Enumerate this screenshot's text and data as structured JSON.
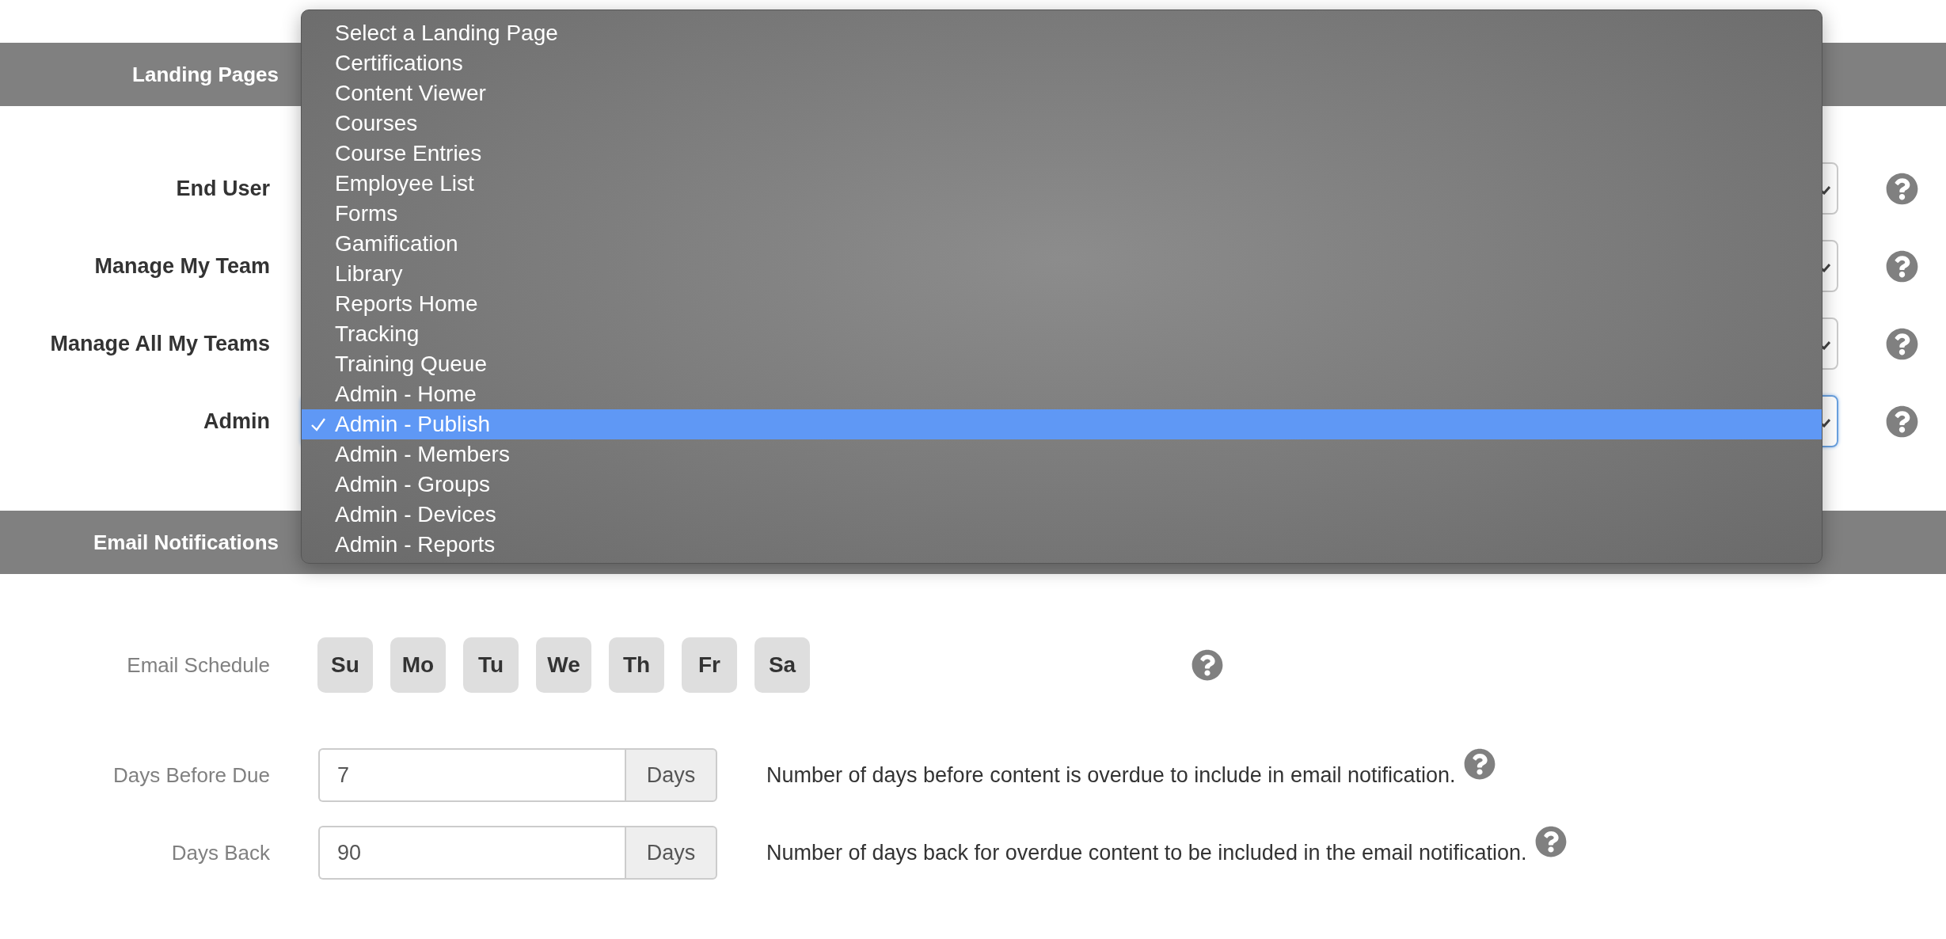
{
  "landing_pages": {
    "title": "Landing Pages",
    "rows": [
      {
        "label": "End User",
        "focused": false
      },
      {
        "label": "Manage My Team",
        "focused": false
      },
      {
        "label": "Manage All My Teams",
        "focused": false
      },
      {
        "label": "Admin",
        "focused": true
      }
    ]
  },
  "dropdown": {
    "options": [
      {
        "label": "Select a Landing Page",
        "selected": false
      },
      {
        "label": "Certifications",
        "selected": false
      },
      {
        "label": "Content Viewer",
        "selected": false
      },
      {
        "label": "Courses",
        "selected": false
      },
      {
        "label": "Course Entries",
        "selected": false
      },
      {
        "label": "Employee List",
        "selected": false
      },
      {
        "label": "Forms",
        "selected": false
      },
      {
        "label": "Gamification",
        "selected": false
      },
      {
        "label": "Library",
        "selected": false
      },
      {
        "label": "Reports Home",
        "selected": false
      },
      {
        "label": "Tracking",
        "selected": false
      },
      {
        "label": "Training Queue",
        "selected": false
      },
      {
        "label": "Admin - Home",
        "selected": false
      },
      {
        "label": "Admin - Publish",
        "selected": true
      },
      {
        "label": "Admin - Members",
        "selected": false
      },
      {
        "label": "Admin - Groups",
        "selected": false
      },
      {
        "label": "Admin - Devices",
        "selected": false
      },
      {
        "label": "Admin - Reports",
        "selected": false
      }
    ]
  },
  "email_notifications": {
    "title": "Email Notifications",
    "schedule": {
      "label": "Email Schedule",
      "days": [
        {
          "label": "Su",
          "selected": false
        },
        {
          "label": "Mo",
          "selected": false
        },
        {
          "label": "Tu",
          "selected": false
        },
        {
          "label": "We",
          "selected": false
        },
        {
          "label": "Th",
          "selected": false
        },
        {
          "label": "Fr",
          "selected": false
        },
        {
          "label": "Sa",
          "selected": false
        }
      ]
    },
    "fields": [
      {
        "label": "Days Before Due",
        "value": "7",
        "unit": "Days",
        "description": "Number of days before content is overdue to include in email notification."
      },
      {
        "label": "Days Back",
        "value": "90",
        "unit": "Days",
        "description": "Number of days back for overdue content to be included in the email notification."
      }
    ]
  }
}
